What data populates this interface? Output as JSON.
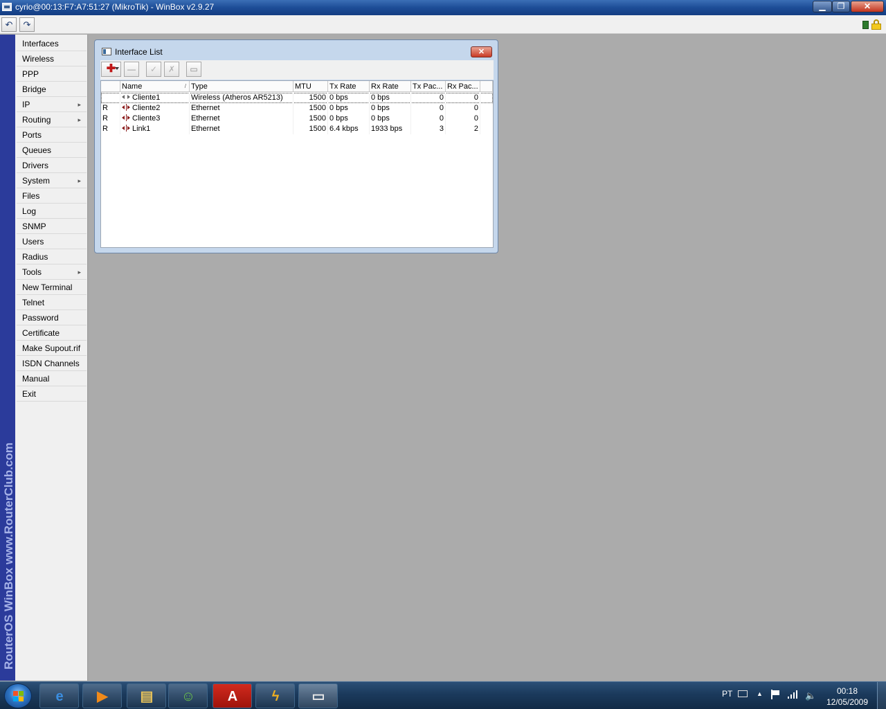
{
  "window": {
    "title": "cyrio@00:13:F7:A7:51:27 (MikroTik) - WinBox v2.9.27",
    "minimize": "▁",
    "maximize": "❐",
    "close": "✕"
  },
  "toolbar": {
    "undo": "↶",
    "redo": "↷"
  },
  "brand": {
    "text": "RouterOS WinBox   www.RouterClub.com"
  },
  "sidebar": {
    "items": [
      {
        "label": "Interfaces",
        "submenu": false
      },
      {
        "label": "Wireless",
        "submenu": false
      },
      {
        "label": "PPP",
        "submenu": false
      },
      {
        "label": "Bridge",
        "submenu": false
      },
      {
        "label": "IP",
        "submenu": true
      },
      {
        "label": "Routing",
        "submenu": true
      },
      {
        "label": "Ports",
        "submenu": false
      },
      {
        "label": "Queues",
        "submenu": false
      },
      {
        "label": "Drivers",
        "submenu": false
      },
      {
        "label": "System",
        "submenu": true
      },
      {
        "label": "Files",
        "submenu": false
      },
      {
        "label": "Log",
        "submenu": false
      },
      {
        "label": "SNMP",
        "submenu": false
      },
      {
        "label": "Users",
        "submenu": false
      },
      {
        "label": "Radius",
        "submenu": false
      },
      {
        "label": "Tools",
        "submenu": true
      },
      {
        "label": "New Terminal",
        "submenu": false
      },
      {
        "label": "Telnet",
        "submenu": false
      },
      {
        "label": "Password",
        "submenu": false
      },
      {
        "label": "Certificate",
        "submenu": false
      },
      {
        "label": "Make Supout.rif",
        "submenu": false
      },
      {
        "label": "ISDN Channels",
        "submenu": false
      },
      {
        "label": "Manual",
        "submenu": false
      },
      {
        "label": "Exit",
        "submenu": false
      }
    ],
    "submenu_arrow": "▸"
  },
  "interface_list": {
    "title": "Interface List",
    "close": "✕",
    "buttons": {
      "add": "✚",
      "remove": "—",
      "enable": "✓",
      "disable": "✗",
      "comment": "▭"
    },
    "columns": [
      "",
      "Name",
      "Type",
      "MTU",
      "Tx Rate",
      "Rx Rate",
      "Tx Pac...",
      "Rx Pac..."
    ],
    "sort_indicator": "/",
    "rows": [
      {
        "flag": "",
        "name": "Cliente1",
        "type": "Wireless (Atheros AR5213)",
        "mtu": "1500",
        "tx_rate": "0 bps",
        "rx_rate": "0 bps",
        "tx_packets": "0",
        "rx_packets": "0",
        "icon": "wireless"
      },
      {
        "flag": "R",
        "name": "Cliente2",
        "type": "Ethernet",
        "mtu": "1500",
        "tx_rate": "0 bps",
        "rx_rate": "0 bps",
        "tx_packets": "0",
        "rx_packets": "0",
        "icon": "ethernet"
      },
      {
        "flag": "R",
        "name": "Cliente3",
        "type": "Ethernet",
        "mtu": "1500",
        "tx_rate": "0 bps",
        "rx_rate": "0 bps",
        "tx_packets": "0",
        "rx_packets": "0",
        "icon": "ethernet"
      },
      {
        "flag": "R",
        "name": "Link1",
        "type": "Ethernet",
        "mtu": "1500",
        "tx_rate": "6.4 kbps",
        "rx_rate": "1933 bps",
        "tx_packets": "3",
        "rx_packets": "2",
        "icon": "ethernet"
      }
    ]
  },
  "taskbar": {
    "buttons": [
      {
        "name": "internet-explorer",
        "glyph": "e",
        "color": "#3b8ee0"
      },
      {
        "name": "media-player",
        "glyph": "▶",
        "color": "#f08a1a"
      },
      {
        "name": "file-explorer",
        "glyph": "▤",
        "color": "#e8c35a"
      },
      {
        "name": "messenger",
        "glyph": "☺",
        "color": "#6bc24a"
      },
      {
        "name": "acrobat",
        "glyph": "A",
        "color": "#ffffff"
      },
      {
        "name": "winamp",
        "glyph": "ϟ",
        "color": "#f0b020"
      },
      {
        "name": "winbox",
        "glyph": "▭",
        "color": "#e8e8e8"
      }
    ]
  },
  "tray": {
    "lang": "PT",
    "up_arrow": "▲",
    "volume": "🔈",
    "time": "00:18",
    "date": "12/05/2009"
  }
}
